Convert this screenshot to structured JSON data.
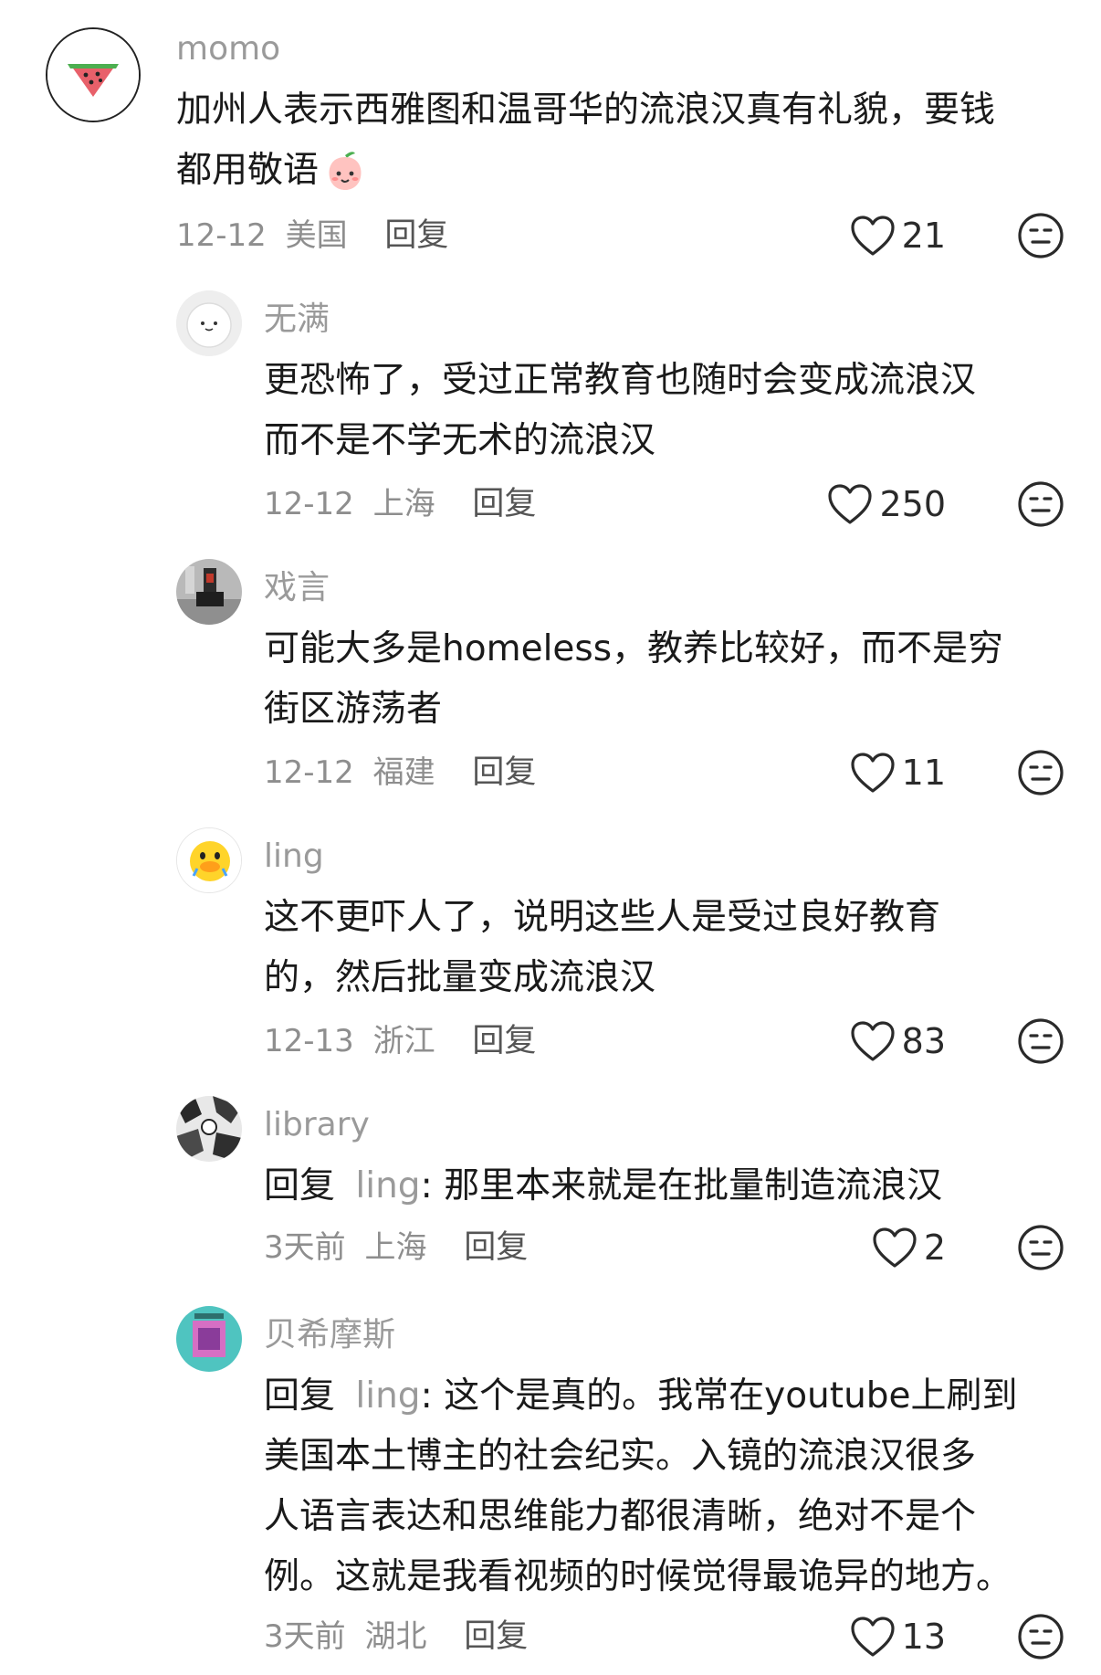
{
  "comments": [
    {
      "author": "momo",
      "avatar_icon": "watermelon-icon",
      "lines": [
        "加州人表示西雅图和温哥华的流浪汉真有礼貌，要钱",
        "都用敬语"
      ],
      "emoji": "peach-face-emoji",
      "date": "12-12",
      "location": "美国",
      "reply_label": "回复",
      "likes": "21"
    },
    {
      "author": "无满",
      "avatar_icon": "white-blob-face-icon",
      "lines": [
        "更恐怖了，受过正常教育也随时会变成流浪汉",
        "而不是不学无术的流浪汉"
      ],
      "date": "12-12",
      "location": "上海",
      "reply_label": "回复",
      "likes": "250"
    },
    {
      "author": "戏言",
      "avatar_icon": "photo-avatar-icon",
      "lines": [
        "可能大多是homeless，教养比较好，而不是穷",
        "街区游荡者"
      ],
      "date": "12-12",
      "location": "福建",
      "reply_label": "回复",
      "likes": "11"
    },
    {
      "author": "ling",
      "avatar_icon": "duck-face-icon",
      "lines": [
        "这不更吓人了，说明这些人是受过良好教育",
        "的，然后批量变成流浪汉"
      ],
      "date": "12-13",
      "location": "浙江",
      "reply_label": "回复",
      "likes": "83"
    },
    {
      "author": "library",
      "avatar_icon": "manga-avatar-icon",
      "reply_prefix": "回复",
      "reply_target": "ling",
      "lines": [
        ": 那里本来就是在批量制造流浪汉"
      ],
      "date": "3天前",
      "location": "上海",
      "reply_label": "回复",
      "likes": "2"
    },
    {
      "author": "贝希摩斯",
      "avatar_icon": "album-cover-icon",
      "reply_prefix": "回复",
      "reply_target": "ling",
      "lines": [
        ": 这个是真的。我常在youtube上刷到",
        "美国本土博主的社会纪实。入镜的流浪汉很多",
        "人语言表达和思维能力都很清晰，绝对不是个",
        "例。这就是我看视频的时候觉得最诡异的地方。"
      ],
      "date": "3天前",
      "location": "湖北",
      "reply_label": "回复",
      "likes": "13"
    }
  ],
  "icons": {
    "like": "heart-outline-icon",
    "dislike": "meh-face-icon"
  },
  "colors": {
    "text": "#1a1a1a",
    "muted": "#9a9a9a",
    "icon": "#2a2a2a"
  }
}
